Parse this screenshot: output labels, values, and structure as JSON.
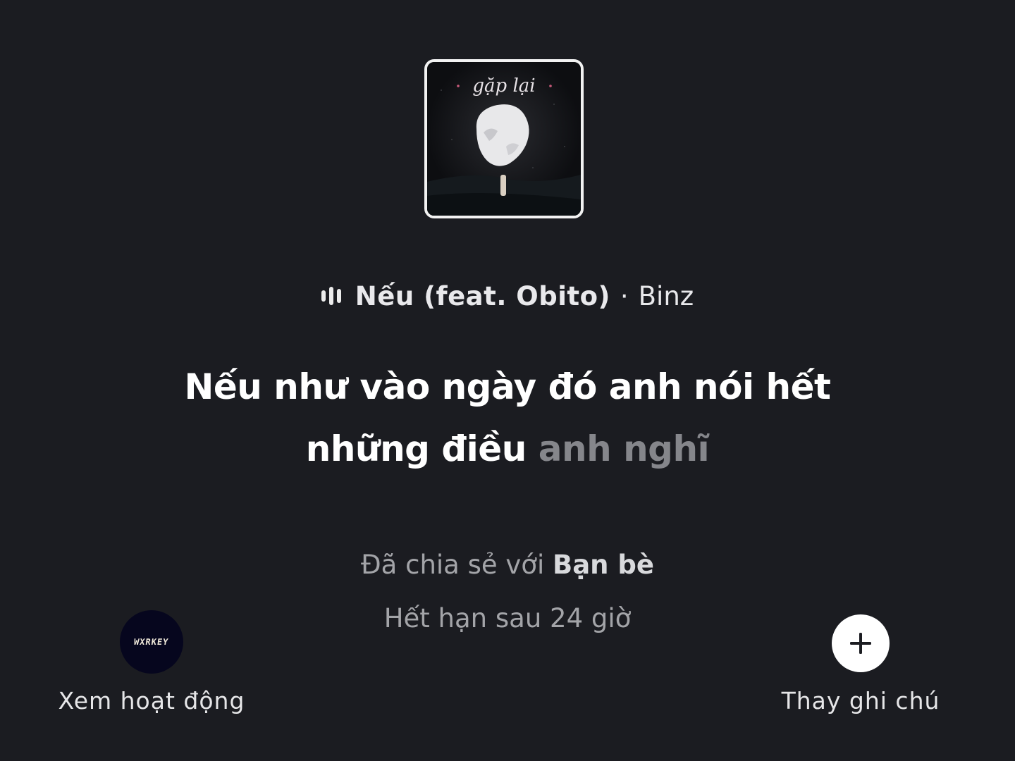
{
  "album": {
    "art_title": "gặp lại"
  },
  "now_playing": {
    "icon": "equalizer-icon",
    "song_title": "Nếu (feat. Obito)",
    "separator": "·",
    "artist": "Binz"
  },
  "lyrics": {
    "line1": "Nếu như vào ngày đó anh nói hết",
    "line2_sung": "những điều ",
    "line2_upcoming": "anh nghĩ"
  },
  "share": {
    "prefix": "Đã chia sẻ với ",
    "audience": "Bạn bè",
    "expiry": "Hết hạn sau 24 giờ"
  },
  "left_action": {
    "avatar_text": "WXRKEY",
    "label": "Xem hoạt động"
  },
  "right_action": {
    "icon": "plus-icon",
    "label": "Thay ghi chú"
  },
  "colors": {
    "background": "#1b1c21",
    "upcoming_lyric": "#85868b",
    "secondary_text": "#a3a4a8"
  }
}
